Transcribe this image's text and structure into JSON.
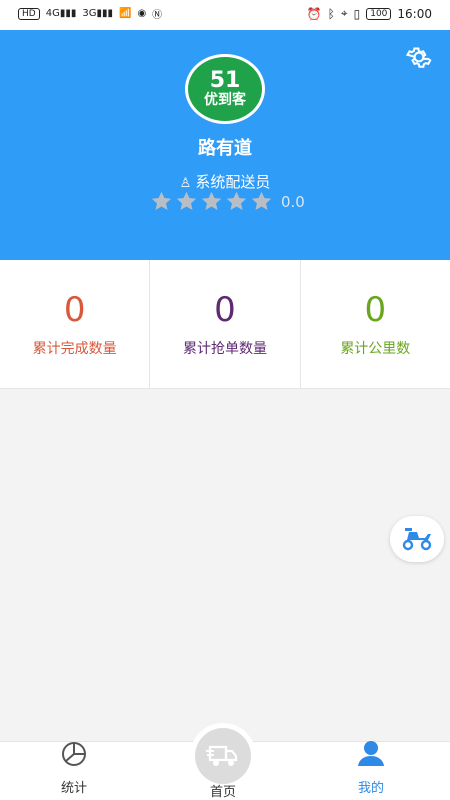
{
  "status_bar": {
    "left": [
      "HD",
      "4G",
      "3G"
    ],
    "battery": "100",
    "time": "16:00"
  },
  "profile": {
    "logo_mark": "51",
    "logo_text": "优到客",
    "name": "路有道",
    "role": "系统配送员",
    "rating": 0.0,
    "rating_text": "0.0",
    "stars": 5
  },
  "stats": [
    {
      "value": "0",
      "label": "累计完成数量",
      "color": "#d9583b"
    },
    {
      "value": "0",
      "label": "累计抢单数量",
      "color": "#5e2a72"
    },
    {
      "value": "0",
      "label": "累计公里数",
      "color": "#6aa51f"
    }
  ],
  "tabbar": {
    "stats_label": "统计",
    "home_label": "首页",
    "me_label": "我的"
  },
  "colors": {
    "header": "#2f9cf7",
    "accent": "#2f89e6"
  }
}
